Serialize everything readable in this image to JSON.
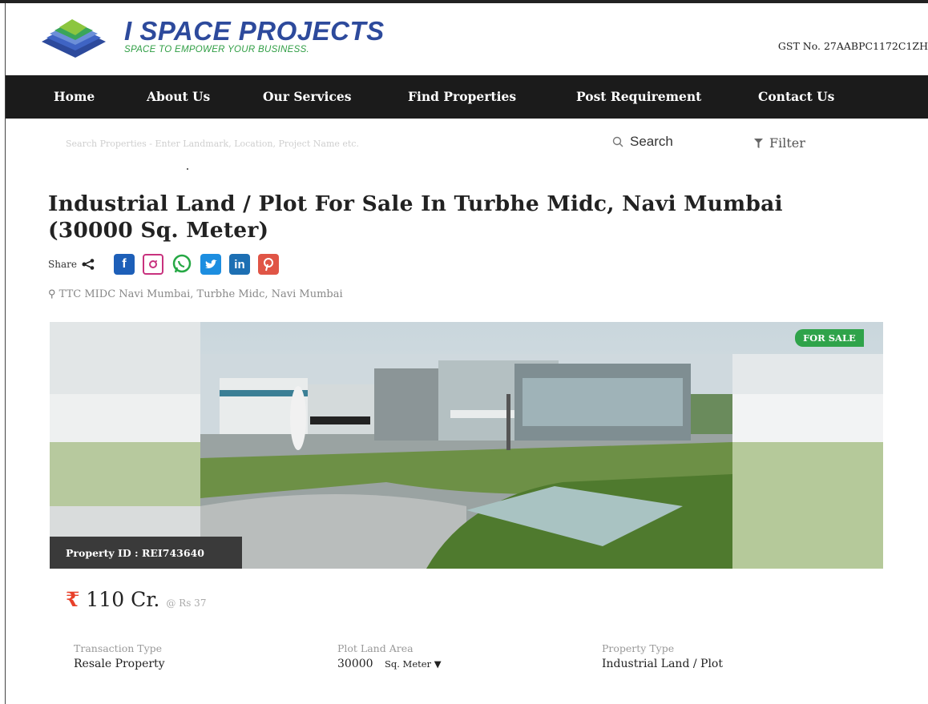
{
  "header": {
    "brand_title": "I SPACE PROJECTS",
    "brand_tagline": "SPACE TO EMPOWER YOUR BUSINESS.",
    "gst": "GST No. 27AABPC1172C1ZH"
  },
  "nav": [
    "Home",
    "About Us",
    "Our Services",
    "Find Properties",
    "Post Requirement",
    "Contact Us"
  ],
  "search": {
    "placeholder": "Search Properties - Enter Landmark, Location, Project Name etc.",
    "button_label": "Search",
    "filter_label": "Filter"
  },
  "property": {
    "title_line1": "Industrial Land / Plot For Sale In Turbhe Midc, Navi Mumbai",
    "title_line2": "(30000 Sq. Meter)",
    "share_label": "Share",
    "location": "TTC MIDC Navi Mumbai, Turbhe Midc, Navi Mumbai",
    "status_badge": "FOR SALE",
    "property_id": "Property ID : REI743640",
    "price": "110 Cr.",
    "rate": "@ Rs 37",
    "details": [
      {
        "label": "Transaction Type",
        "value": "Resale Property"
      },
      {
        "label": "Plot  Land Area",
        "value": "30000",
        "unit": "Sq. Meter"
      },
      {
        "label": "Property Type",
        "value": "Industrial Land / Plot"
      }
    ]
  },
  "colors": {
    "nav_bg": "#1b1b1b",
    "brand_blue": "#2d4a9c",
    "brand_green": "#2f9e44",
    "sale_badge": "#2fa34a",
    "rupee": "#e8402a"
  }
}
